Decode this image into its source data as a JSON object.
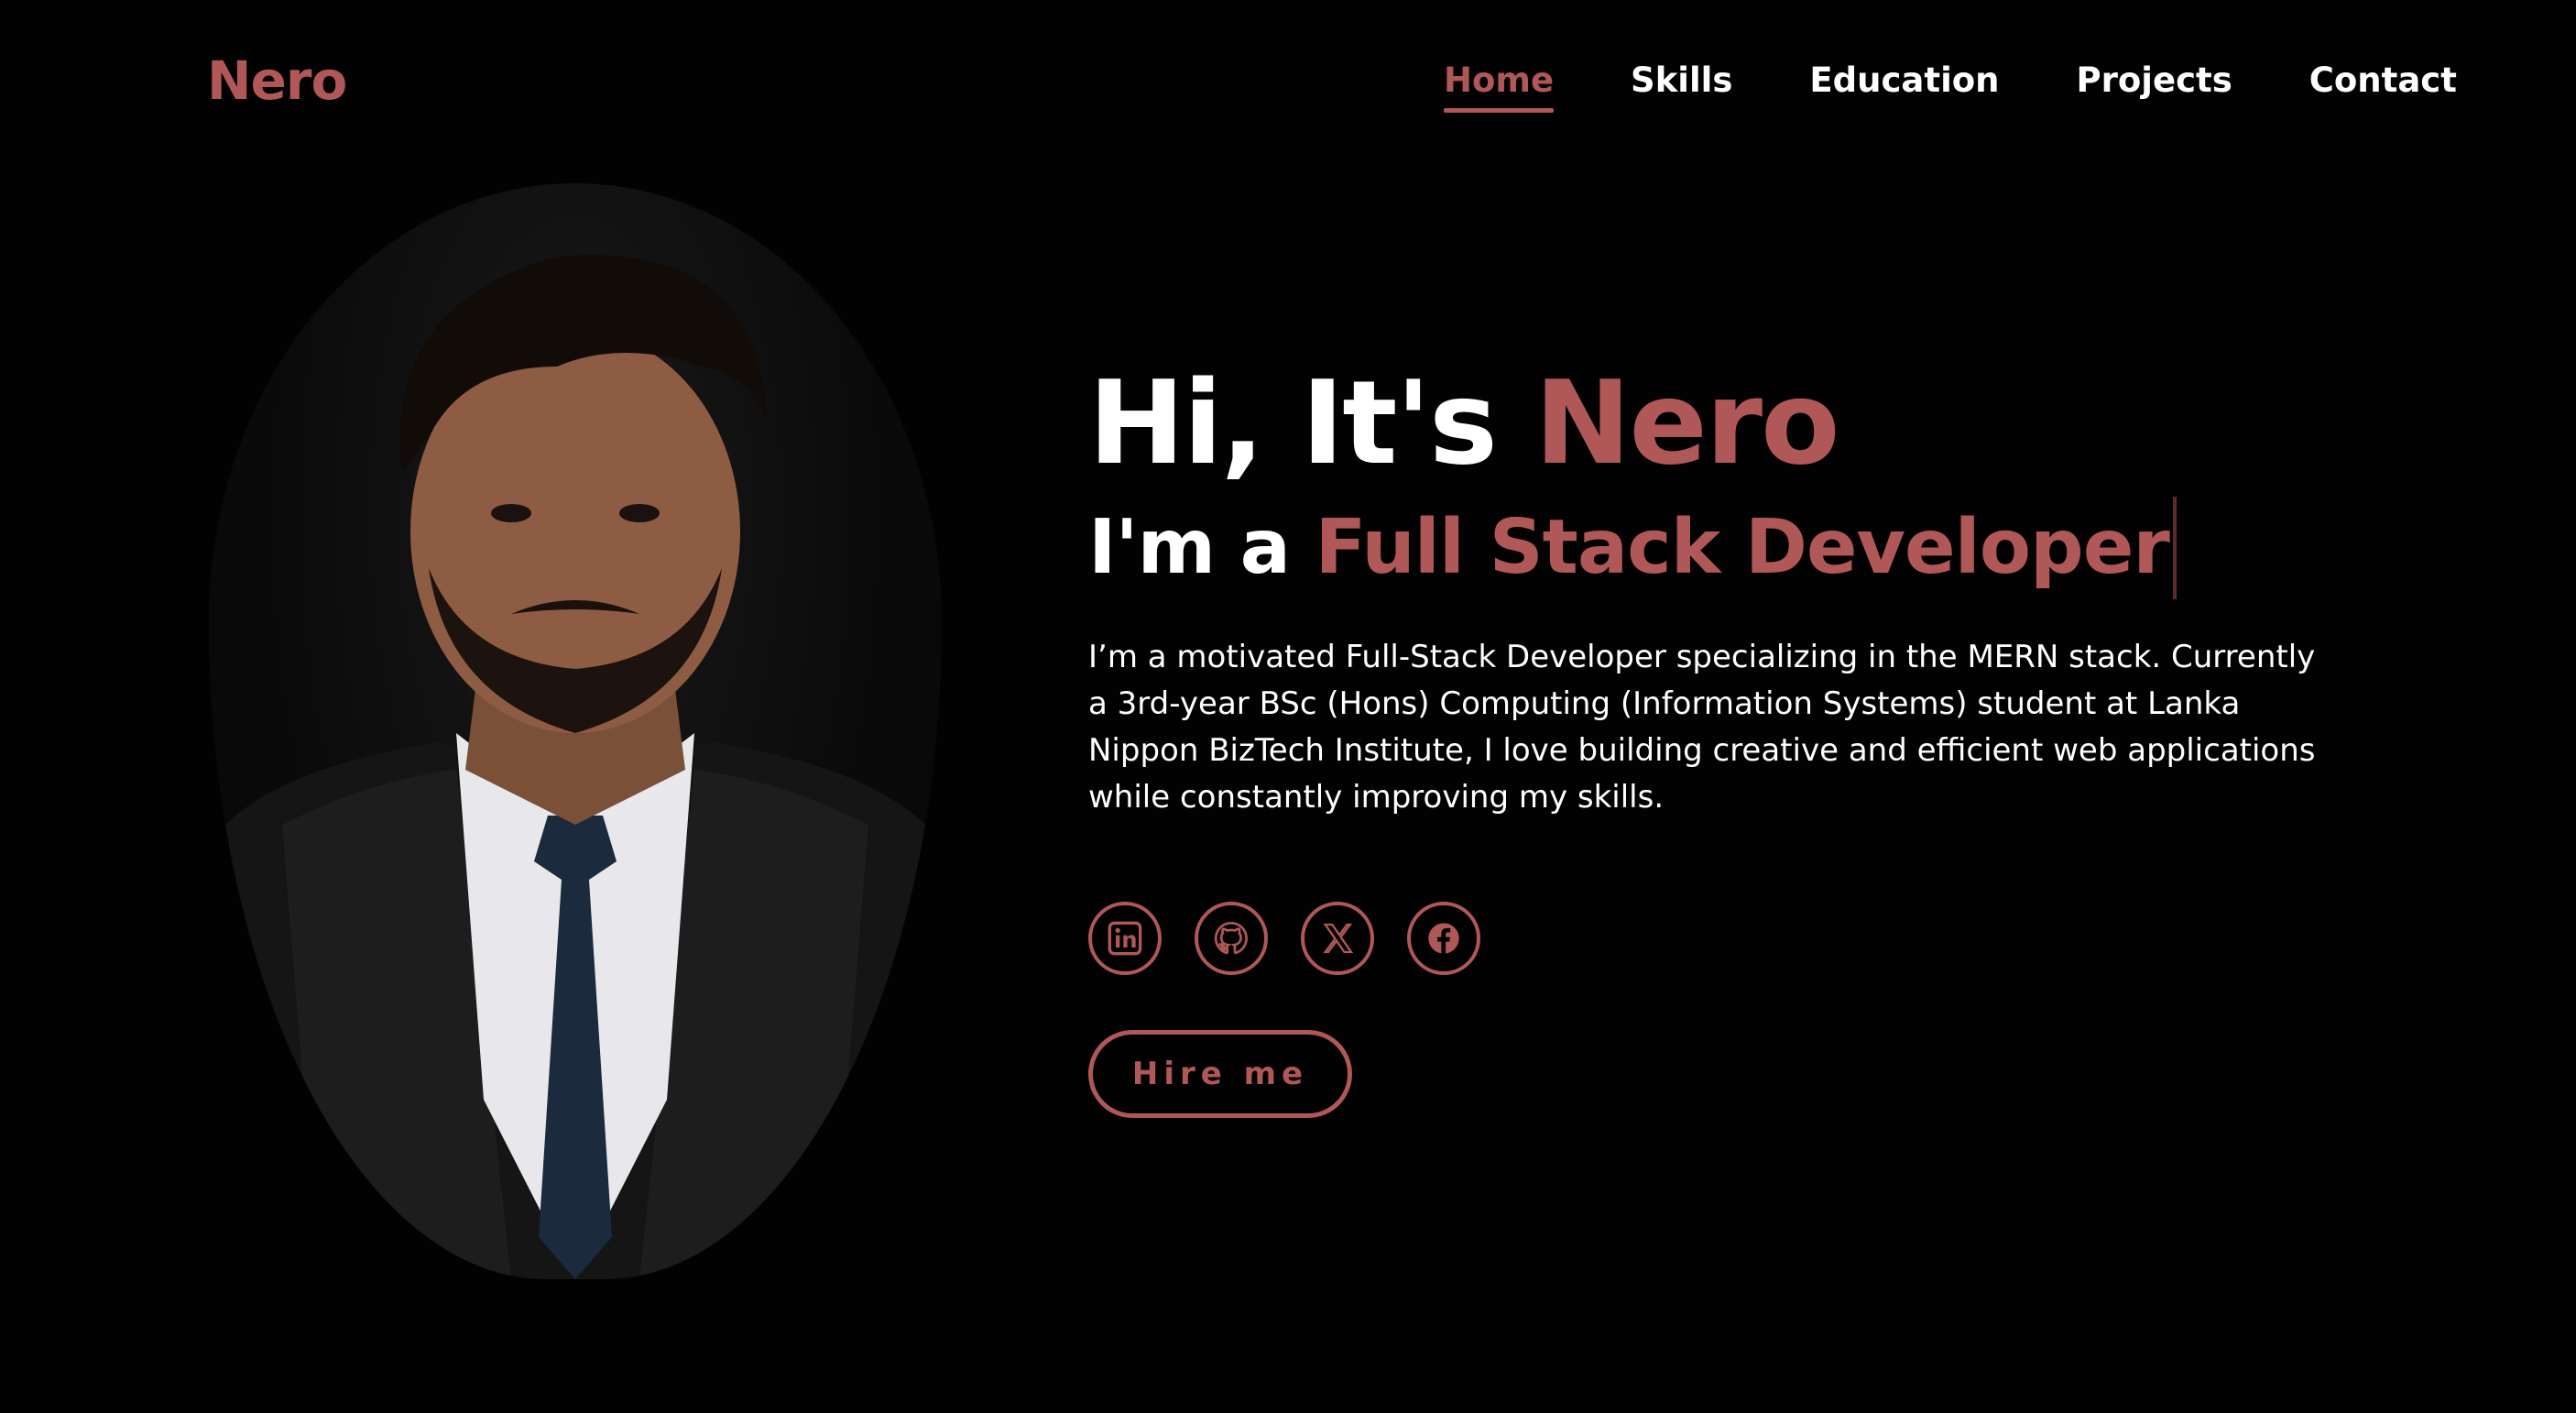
{
  "brand": {
    "logo": "Nero",
    "accent_color": "#b05757"
  },
  "nav": {
    "items": [
      {
        "label": "Home",
        "active": true
      },
      {
        "label": "Skills"
      },
      {
        "label": "Education"
      },
      {
        "label": "Projects"
      },
      {
        "label": "Contact"
      }
    ]
  },
  "hero": {
    "greeting_prefix": "Hi, It's ",
    "greeting_name": "Nero",
    "role_prefix": "I'm a ",
    "role": "Full Stack Developer",
    "bio": "I’m a motivated Full-Stack Developer specializing in the MERN stack. Currently a 3rd-year BSc (Hons) Computing (Information Systems) student at Lanka Nippon BizTech Institute, I love building creative and efficient web applications while constantly improving my skills.",
    "hire_label": "Hire me"
  },
  "social": [
    {
      "icon": "linkedin-icon"
    },
    {
      "icon": "github-icon"
    },
    {
      "icon": "x-icon"
    },
    {
      "icon": "facebook-icon"
    }
  ]
}
